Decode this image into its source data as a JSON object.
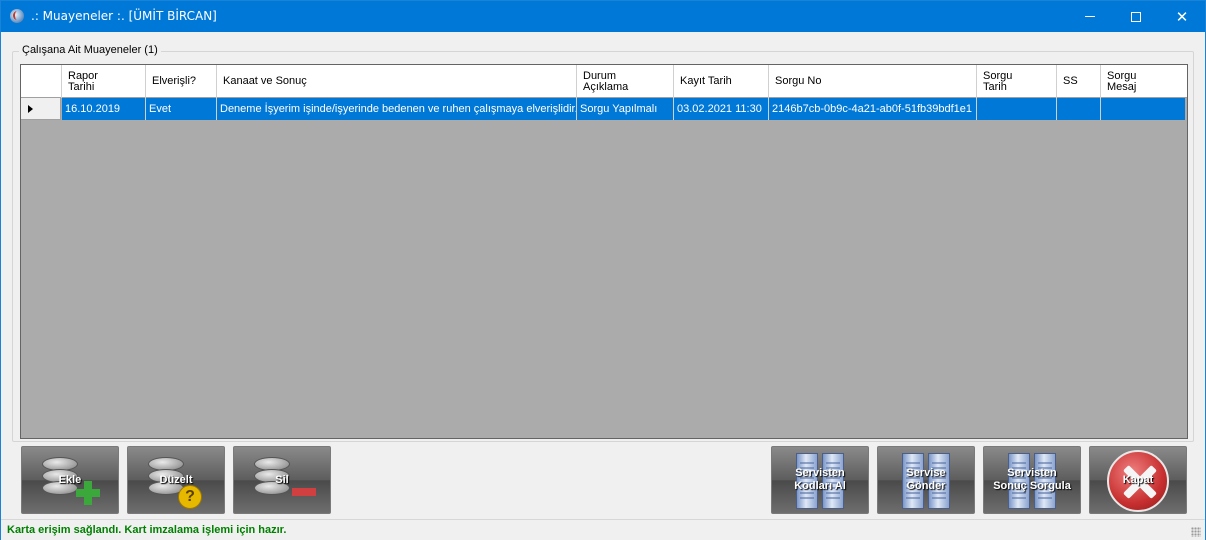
{
  "window": {
    "title": ".: Muayeneler :. [ÜMİT BİRCAN]"
  },
  "group": {
    "title": "Çalışana Ait Muayeneler (1)"
  },
  "grid": {
    "columns": [
      "Rapor\nTarihi",
      "Elverişli?",
      "Kanaat ve Sonuç",
      "Durum\nAçıklama",
      "Kayıt Tarih",
      "Sorgu No",
      "Sorgu\nTarih",
      "SS",
      "Sorgu\nMesaj"
    ],
    "rows": [
      [
        "16.10.2019",
        "Evet",
        "Deneme İşyerim işinde/işyerinde bedenen ve ruhen çalışmaya elverişlidir.",
        "Sorgu Yapılmalı",
        "03.02.2021 11:30",
        "2146b7cb-0b9c-4a21-ab0f-51fb39bdf1e1",
        "",
        "",
        ""
      ]
    ]
  },
  "buttons": {
    "add": "Ekle",
    "edit": "Düzelt",
    "delete": "Sil",
    "fetch_codes": "Servisten\nKodları Al",
    "send": "Servise\nGönder",
    "query_result": "Servisten\nSonuç Sorgula",
    "close": "Kapat"
  },
  "status": {
    "text": "Karta erişim sağlandı. Kart imzalama işlemi için hazır."
  },
  "colors": {
    "titlebar": "#0078d7",
    "selection": "#0078d7",
    "status": "#008000"
  },
  "icons": [
    "app-icon",
    "database-add-icon",
    "database-help-icon",
    "database-remove-icon",
    "server-icon",
    "close-circle-icon",
    "resize-grip-icon"
  ]
}
